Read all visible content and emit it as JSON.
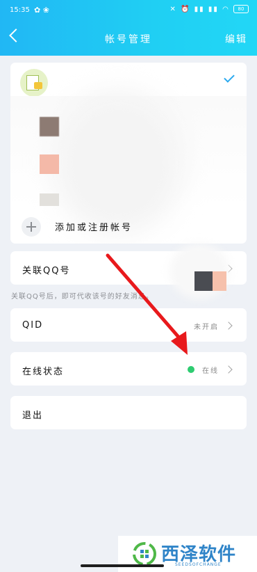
{
  "status_bar": {
    "time": "15:35",
    "battery": "80"
  },
  "nav": {
    "title": "帐号管理",
    "edit_label": "编辑"
  },
  "accounts": {
    "add_label": "添加或注册帐号"
  },
  "linked_qq": {
    "label": "关联QQ号",
    "hint": "关联QQ号后，即可代收该号的好友消息。"
  },
  "qid": {
    "label": "QID",
    "value": "未开启"
  },
  "online_status": {
    "label": "在线状态",
    "value": "在线",
    "dot_color": "#2ecc71"
  },
  "logout": {
    "label": "退出"
  },
  "watermark": {
    "name": "西泽软件",
    "sub": "SEEDSOFCHANGE"
  },
  "colors": {
    "header": "#21b7f4",
    "accent": "#2aa9ef",
    "arrow": "#e8191c"
  }
}
